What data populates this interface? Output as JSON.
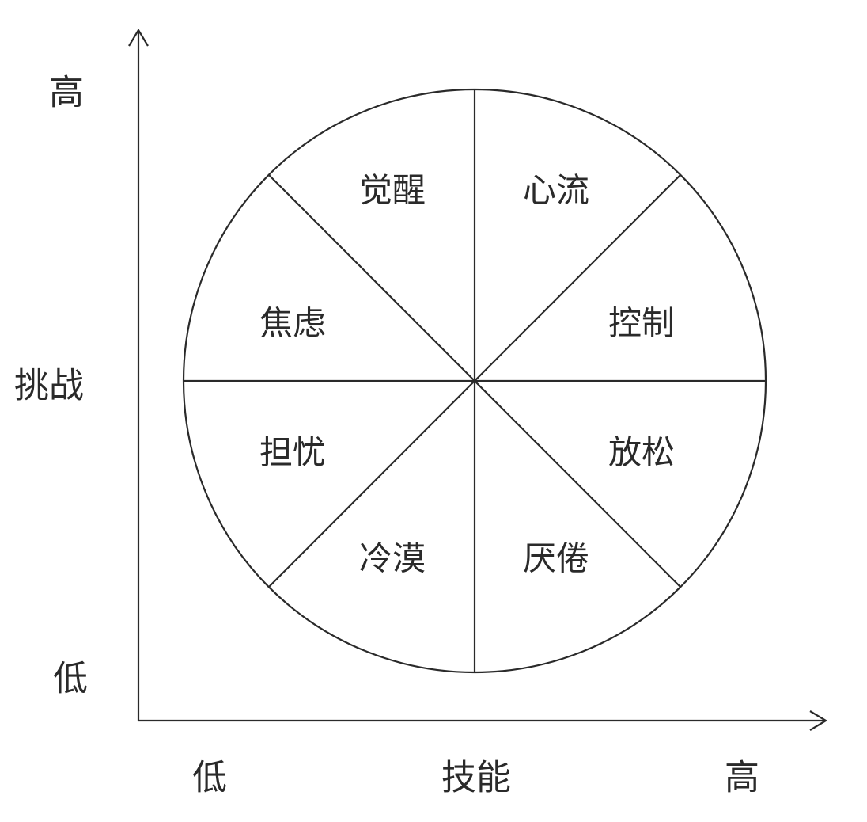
{
  "y_axis": {
    "title": "挑战",
    "high_label": "高",
    "low_label": "低"
  },
  "x_axis": {
    "title": "技能",
    "low_label": "低",
    "high_label": "高"
  },
  "sectors": [
    {
      "id": "flow",
      "label": "心流"
    },
    {
      "id": "control",
      "label": "控制"
    },
    {
      "id": "relaxation",
      "label": "放松"
    },
    {
      "id": "boredom",
      "label": "厌倦"
    },
    {
      "id": "apathy",
      "label": "冷漠"
    },
    {
      "id": "worry",
      "label": "担忧"
    },
    {
      "id": "anxiety",
      "label": "焦虑"
    },
    {
      "id": "arousal",
      "label": "觉醒"
    }
  ]
}
